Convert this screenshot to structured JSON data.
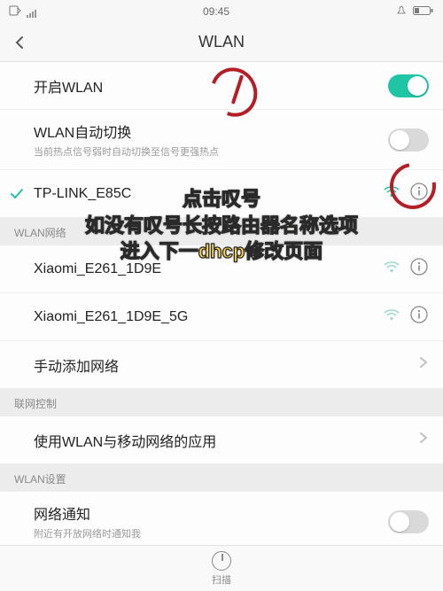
{
  "statusbar": {
    "time": "09:45"
  },
  "nav": {
    "title": "WLAN"
  },
  "wlan": {
    "enable_label": "开启WLAN",
    "enable_on": true,
    "auto_switch_label": "WLAN自动切换",
    "auto_switch_sub": "当前热点信号弱时自动切换至信号更强热点",
    "auto_switch_on": false
  },
  "connected": {
    "name": "TP-LINK_E85C"
  },
  "section_networks": "WLAN网络",
  "networks": [
    {
      "name": "Xiaomi_E261_1D9E"
    },
    {
      "name": "Xiaomi_E261_1D9E_5G"
    }
  ],
  "manual_add": "手动添加网络",
  "section_control": "联网控制",
  "apps_row": "使用WLAN与移动网络的应用",
  "section_settings": "WLAN设置",
  "notify": {
    "label": "网络通知",
    "sub": "附近有开放网络时通知我",
    "on": false
  },
  "tabbar": {
    "scan": "扫描"
  },
  "annotation": {
    "line1": "点击叹号",
    "line2": "如没有叹号长按路由器名称选项",
    "line3": "进入下一dhcp修改页面"
  },
  "colors": {
    "accent": "#1fc6a6",
    "annotation_red": "#b41e26",
    "annotation_yellow": "#ffd64a"
  }
}
